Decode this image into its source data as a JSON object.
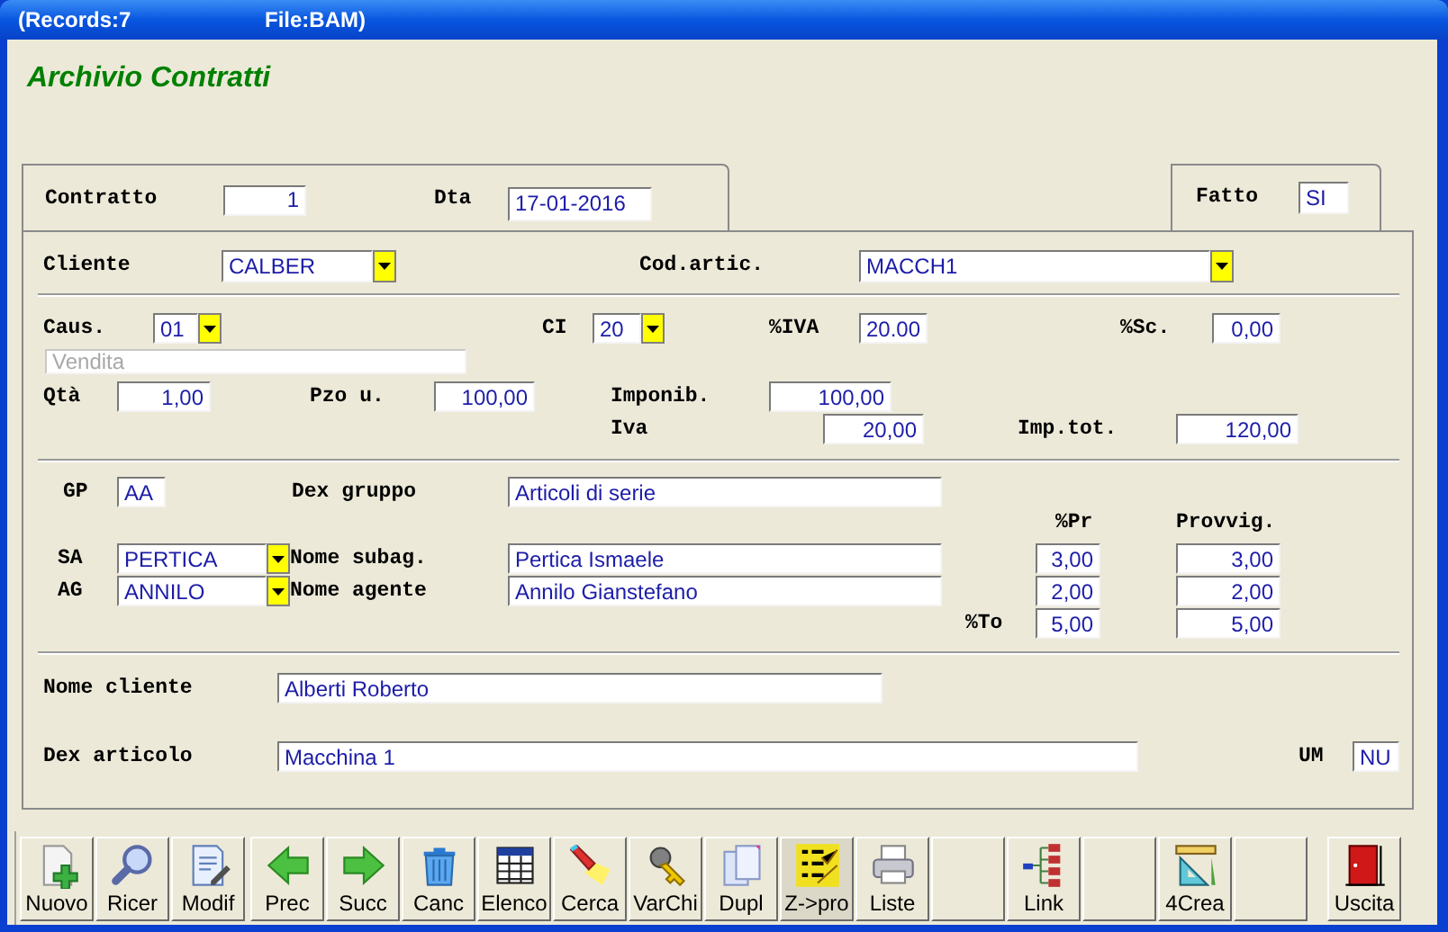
{
  "window": {
    "records": "(Records:7",
    "file": "File:BAM)"
  },
  "heading": "Archivio Contratti",
  "header_fields": [
    {
      "label": "Contratto",
      "value": "1",
      "kind": "number"
    },
    {
      "label": "Dta",
      "value": "17-01-2016",
      "kind": "text"
    }
  ],
  "fatto": {
    "label": "Fatto",
    "value": "SI"
  },
  "sections": [
    {
      "rows": [
        {
          "items": [
            {
              "kind": "label",
              "text": "Cliente"
            },
            {
              "kind": "combo",
              "value": "CALBER"
            },
            {
              "kind": "label",
              "text": "Cod.artic."
            },
            {
              "kind": "combo",
              "value": "MACCH1"
            }
          ]
        }
      ]
    },
    {
      "rows": [
        {
          "items": [
            {
              "kind": "label",
              "text": "Caus."
            },
            {
              "kind": "combo",
              "value": "01"
            },
            {
              "kind": "label",
              "text": "CI"
            },
            {
              "kind": "combo",
              "value": "20"
            },
            {
              "kind": "label",
              "text": "%IVA"
            },
            {
              "kind": "number",
              "value": "20.00"
            },
            {
              "kind": "label",
              "text": "%Sc."
            },
            {
              "kind": "number",
              "value": "0,00"
            }
          ]
        },
        {
          "items": [
            {
              "kind": "disabled",
              "value": "Vendita"
            }
          ]
        },
        {
          "items": [
            {
              "kind": "label",
              "text": "Qtà"
            },
            {
              "kind": "number",
              "value": "1,00"
            },
            {
              "kind": "label",
              "text": "Pzo u."
            },
            {
              "kind": "number",
              "value": "100,00"
            },
            {
              "kind": "label",
              "text": "Imponib."
            },
            {
              "kind": "number",
              "value": "100,00"
            }
          ]
        },
        {
          "items": [
            {
              "kind": "label",
              "text": "Iva"
            },
            {
              "kind": "number",
              "value": "20,00"
            },
            {
              "kind": "label",
              "text": "Imp.tot."
            },
            {
              "kind": "number",
              "value": "120,00"
            }
          ]
        }
      ]
    },
    {
      "rows": [
        {
          "items": [
            {
              "kind": "label",
              "text": "GP"
            },
            {
              "kind": "text",
              "value": "AA"
            },
            {
              "kind": "label",
              "text": "Dex gruppo"
            },
            {
              "kind": "text",
              "value": "Articoli di serie"
            }
          ]
        },
        {
          "items": [
            {
              "kind": "label",
              "text": "%Pr"
            },
            {
              "kind": "label",
              "text": "Provvig."
            }
          ]
        },
        {
          "items": [
            {
              "kind": "label",
              "text": "SA"
            },
            {
              "kind": "combo",
              "value": "PERTICA"
            },
            {
              "kind": "label",
              "text": "Nome subag."
            },
            {
              "kind": "text",
              "value": "Pertica Ismaele"
            },
            {
              "kind": "number",
              "value": "3,00"
            },
            {
              "kind": "number",
              "value": "3,00"
            }
          ]
        },
        {
          "items": [
            {
              "kind": "label",
              "text": "AG"
            },
            {
              "kind": "combo",
              "value": "ANNILO"
            },
            {
              "kind": "label",
              "text": "Nome agente"
            },
            {
              "kind": "text",
              "value": "Annilo Gianstefano"
            },
            {
              "kind": "number",
              "value": "2,00"
            },
            {
              "kind": "number",
              "value": "2,00"
            }
          ]
        },
        {
          "items": [
            {
              "kind": "label",
              "text": "%To"
            },
            {
              "kind": "number",
              "value": "5,00"
            },
            {
              "kind": "number",
              "value": "5,00"
            }
          ]
        }
      ]
    },
    {
      "rows": [
        {
          "items": [
            {
              "kind": "label",
              "text": "Nome cliente"
            },
            {
              "kind": "text",
              "value": "Alberti Roberto"
            }
          ]
        },
        {
          "items": [
            {
              "kind": "label",
              "text": "Dex articolo"
            },
            {
              "kind": "text",
              "value": "Macchina 1"
            },
            {
              "kind": "label",
              "text": "UM"
            },
            {
              "kind": "text",
              "value": "NU"
            }
          ]
        }
      ]
    }
  ],
  "toolbar": [
    {
      "kind": "button",
      "label": "Nuovo",
      "selected": false
    },
    {
      "kind": "button",
      "label": "Ricer",
      "selected": false
    },
    {
      "kind": "button",
      "label": "Modif",
      "selected": false
    },
    {
      "kind": "button",
      "label": "Prec",
      "selected": false
    },
    {
      "kind": "button",
      "label": "Succ",
      "selected": false
    },
    {
      "kind": "button",
      "label": "Canc",
      "selected": false
    },
    {
      "kind": "button",
      "label": "Elenco",
      "selected": false
    },
    {
      "kind": "button",
      "label": "Cerca",
      "selected": false
    },
    {
      "kind": "button",
      "label": "VarChi",
      "selected": false
    },
    {
      "kind": "button",
      "label": "Dupl",
      "selected": false
    },
    {
      "kind": "button",
      "label": "Z->pro",
      "selected": true
    },
    {
      "kind": "button",
      "label": "Liste",
      "selected": false
    },
    {
      "kind": "blank",
      "selected": false
    },
    {
      "kind": "button",
      "label": "Link",
      "selected": false
    },
    {
      "kind": "blank",
      "selected": false
    },
    {
      "kind": "button",
      "label": "4Crea",
      "selected": false
    },
    {
      "kind": "blank",
      "selected": false
    },
    {
      "kind": "button",
      "label": "Uscita",
      "selected": false
    }
  ]
}
